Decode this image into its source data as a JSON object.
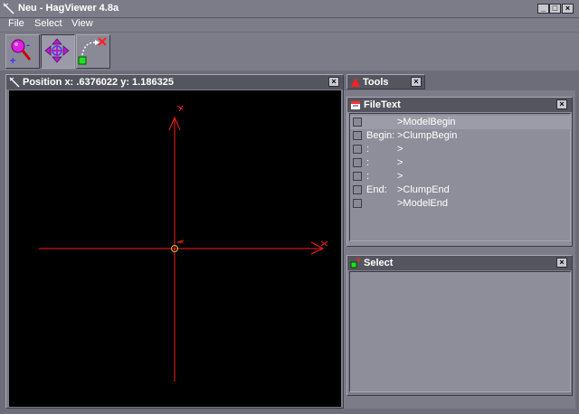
{
  "window": {
    "title": "Neu - HagViewer 4.8a",
    "min": "_",
    "max": "□",
    "close": "×"
  },
  "menu": [
    {
      "label": "File"
    },
    {
      "label": "Select"
    },
    {
      "label": "View"
    }
  ],
  "position_panel": {
    "title": "Position  x: .6376022  y: 1.186325",
    "close": "×"
  },
  "tools_panel": {
    "title": "Tools",
    "close": "×"
  },
  "filetext_panel": {
    "title": "FileText",
    "close": "×",
    "rows": [
      {
        "c2": "",
        "c3": ">ModelBegin"
      },
      {
        "c2": "Begin:",
        "c3": ">ClumpBegin"
      },
      {
        "c2": ":",
        "c3": ">"
      },
      {
        "c2": ":",
        "c3": ">"
      },
      {
        "c2": ":",
        "c3": ">"
      },
      {
        "c2": "End:",
        "c3": ">ClumpEnd"
      },
      {
        "c2": "",
        "c3": ">ModelEnd"
      }
    ]
  },
  "select_panel": {
    "title": "Select",
    "close": "×"
  },
  "colors": {
    "axis": "#ff1a1a",
    "origin": "#c8c820",
    "viewport_bg": "#000000",
    "panel_title": "#55555f"
  }
}
